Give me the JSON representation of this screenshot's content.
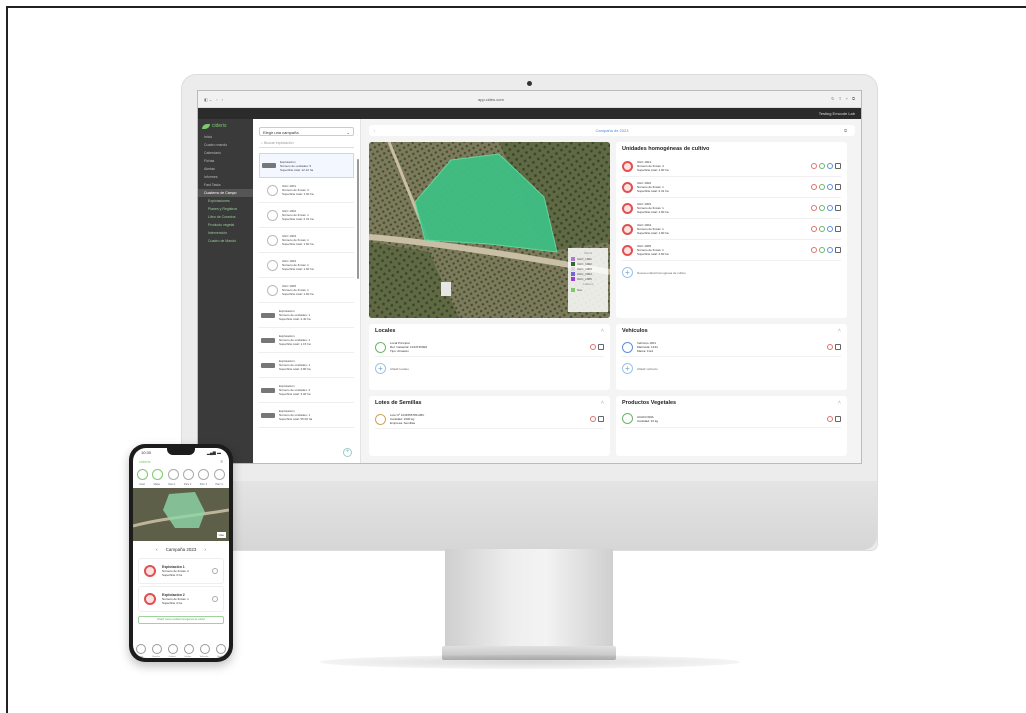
{
  "browser": {
    "url": "app.cides.com",
    "nav": [
      "◧ ⌄",
      "‹",
      "›"
    ],
    "right_icons": [
      "↻",
      "⇪",
      "+",
      "⧉"
    ]
  },
  "app": {
    "user": "Testing Emcode Lab",
    "logo": "cideris",
    "sidebar": [
      {
        "label": "Inicio",
        "active": false,
        "sub": false
      },
      {
        "label": "Cuadro mando",
        "active": false,
        "sub": false
      },
      {
        "label": "Calendario",
        "active": false,
        "sub": false
      },
      {
        "label": "Fichas",
        "active": false,
        "sub": false
      },
      {
        "label": "Alertas",
        "active": false,
        "sub": false
      },
      {
        "label": "Informes",
        "active": false,
        "sub": false
      },
      {
        "label": "Fast Tasks",
        "active": false,
        "sub": false
      },
      {
        "label": "Cuaderno de Campo",
        "active": true,
        "sub": false
      },
      {
        "label": "Explotaciones",
        "active": false,
        "sub": true
      },
      {
        "label": "Planes y Registros",
        "active": false,
        "sub": true
      },
      {
        "label": "Libro de Cosecha",
        "active": false,
        "sub": true
      },
      {
        "label": "Producto vegetal",
        "active": false,
        "sub": true
      },
      {
        "label": "Intervención",
        "active": false,
        "sub": true
      },
      {
        "label": "Cuadro de Mando",
        "active": false,
        "sub": true
      }
    ],
    "list": {
      "select_label": "Elegir una campaña",
      "search_placeholder": "Buscar explotación",
      "rows": [
        {
          "kind": "thumb",
          "title": "Explotación",
          "l1": "Número de unidades: 5",
          "l2": "Superficie total: 12.10 ha",
          "selected": true
        },
        {
          "kind": "circle",
          "title": "UHC 1001",
          "l1": "Número de fincas: 3",
          "l2": "Superficie total: 1.60 ha",
          "selected": false
        },
        {
          "kind": "circle",
          "title": "UHC 1002",
          "l1": "Número de fincas: 1",
          "l2": "Superficie total: 2.31 ha",
          "selected": false
        },
        {
          "kind": "circle",
          "title": "UHC 1003",
          "l1": "Número de fincas: 1",
          "l2": "Superficie total: 1.60 ha",
          "selected": false
        },
        {
          "kind": "circle",
          "title": "UHC 1004",
          "l1": "Número de fincas: 1",
          "l2": "Superficie total: 1.60 ha",
          "selected": false
        },
        {
          "kind": "circle",
          "title": "UHC 1005",
          "l1": "Número de fincas: 1",
          "l2": "Superficie total: 1.60 ha",
          "selected": false
        },
        {
          "kind": "thumb",
          "title": "Explotación",
          "l1": "Número de unidades: 1",
          "l2": "Superficie total: 4.40 ha",
          "selected": false
        },
        {
          "kind": "thumb",
          "title": "Explotación",
          "l1": "Número de unidades: 1",
          "l2": "Superficie total: 1.15 ha",
          "selected": false
        },
        {
          "kind": "thumb",
          "title": "Explotación",
          "l1": "Número de unidades: 1",
          "l2": "Superficie total: 4.80 ha",
          "selected": false
        },
        {
          "kind": "thumb",
          "title": "Explotación",
          "l1": "Número de unidades: 2",
          "l2": "Superficie total: 3.00 ha",
          "selected": false
        },
        {
          "kind": "thumb",
          "title": "Explotación",
          "l1": "Número de unidades: 1",
          "l2": "Superficie total: 55.00 ha",
          "selected": false
        }
      ]
    },
    "main": {
      "topbar": "Campaña de 2023",
      "topbar_left": "‹",
      "topbar_right": "⧉",
      "map_legend_title": "UHCs",
      "map_legend": [
        {
          "label": "UHC_1001",
          "color": "#b07bd6"
        },
        {
          "label": "UHC_1002",
          "color": "#2f6d2f"
        },
        {
          "label": "UHC_1003",
          "color": "#d8d8d8"
        },
        {
          "label": "UHC_1004",
          "color": "#7b63d6"
        },
        {
          "label": "UHC_1005",
          "color": "#9a3fd0"
        }
      ],
      "map_legend_foot": "Cultivos",
      "map_legend_toggle": "Uso",
      "uhc": {
        "title": "Unidades homogéneas de cultivo",
        "rows": [
          {
            "title": "UHC 1001",
            "l1": "Número de fincas: 3",
            "l2": "Superficie total: 1.60 ha"
          },
          {
            "title": "UHC 1002",
            "l1": "Número de fincas: 1",
            "l2": "Superficie total: 2.31 ha"
          },
          {
            "title": "UHC 1003",
            "l1": "Número de fincas: 1",
            "l2": "Superficie total: 1.60 ha"
          },
          {
            "title": "UHC 1004",
            "l1": "Número de fincas: 1",
            "l2": "Superficie total: 1.60 ha"
          },
          {
            "title": "UHC 1005",
            "l1": "Número de fincas: 1",
            "l2": "Superficie total: 2.60 ha"
          }
        ],
        "add_label": "Nueva unidad homogénea de cultivo"
      },
      "locales": {
        "title": "Locales",
        "row": {
          "title": "Local Principal",
          "l1": "Ref. Catastral: 1234T454E5",
          "l2": "Tipo: Almacén"
        },
        "add_label": "Añadir locales"
      },
      "vehiculos": {
        "title": "Vehículos",
        "row": {
          "title": "Vehículo 1001",
          "l1": "Matrícula: 1234",
          "l2": "Marca: Ford"
        },
        "add_label": "Añadir vehículo"
      },
      "lotes": {
        "title": "Lotes de Semillas",
        "row": {
          "title": "Lote Nº 1234556789 ABC",
          "l1": "Cantidad: 1000 kg",
          "l2": "Empresa: Semillas"
        }
      },
      "productos": {
        "title": "Productos Vegetales",
        "row": {
          "title": "ACHICORIA",
          "l1": "Cantidad: 10 kg"
        }
      }
    }
  },
  "phone": {
    "time": "10:30",
    "signal": "▂▄▆ ▬",
    "logo": "cideris",
    "menu": "≡",
    "icon_labels": [
      "Inicio",
      "Mapa",
      "Parc 1",
      "Parc 2",
      "Parc 3",
      "Parc 4"
    ],
    "map_badge": "Uso",
    "campaign": "Campaña 2023",
    "prev": "‹",
    "next": "›",
    "cards": [
      {
        "title": "Explotación 1",
        "l1": "Número de fincas: 2",
        "l2": "Superficie 3 ha"
      },
      {
        "title": "Explotación 2",
        "l1": "Número de fincas: 1",
        "l2": "Superficie 4 ha"
      }
    ],
    "add_label": "Añadir nueva unidad homogénea de cultivo",
    "bottom_labels": [
      "Explot.",
      "Parcelas",
      "Cultivos",
      "Locales",
      "Vehículos",
      "Semillas"
    ]
  }
}
